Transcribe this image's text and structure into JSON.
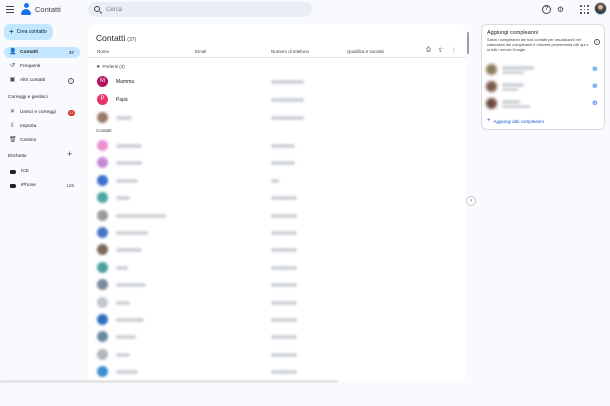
{
  "app": {
    "title": "Contatti"
  },
  "search": {
    "placeholder": "Cerca"
  },
  "sidebar": {
    "create_label": "Crea contatto",
    "items": [
      {
        "label": "Contatti",
        "count": "37"
      },
      {
        "label": "Frequenti"
      },
      {
        "label": "Altri contatti"
      }
    ],
    "fix_manage_title": "Correggi e gestisci",
    "fix_items": [
      {
        "label": "Unisci e correggi",
        "badge": "12"
      },
      {
        "label": "Importa"
      },
      {
        "label": "Cestino"
      }
    ],
    "labels_title": "Etichette",
    "labels": [
      {
        "label": "ICE"
      },
      {
        "label": "iPhone",
        "count": "125"
      }
    ]
  },
  "main": {
    "title": "Contatti",
    "count": "(37)",
    "columns": [
      "Nome",
      "Email",
      "Numero di telefono",
      "Qualifica e società"
    ],
    "favorites_label": "Preferiti (3)",
    "contacts_label": "Contatti",
    "favorites": [
      {
        "initial": "M",
        "name": "Mamma",
        "color": "#b3135b"
      },
      {
        "initial": "P",
        "name": "Papà",
        "color": "#e8336b"
      }
    ]
  },
  "panel": {
    "title": "Aggiungi compleanni",
    "description": "Salva i compleanni del tuoi contatti per visualizzarli nel calendario dei compleanni e ricevere promemoria utili qui e in tutti i servizi Google",
    "link_label": "Aggiungi altri compleanni"
  },
  "colors": {
    "accent": "#1a73e8",
    "active_nav": "#c2e7ff",
    "badge": "#d93025"
  }
}
